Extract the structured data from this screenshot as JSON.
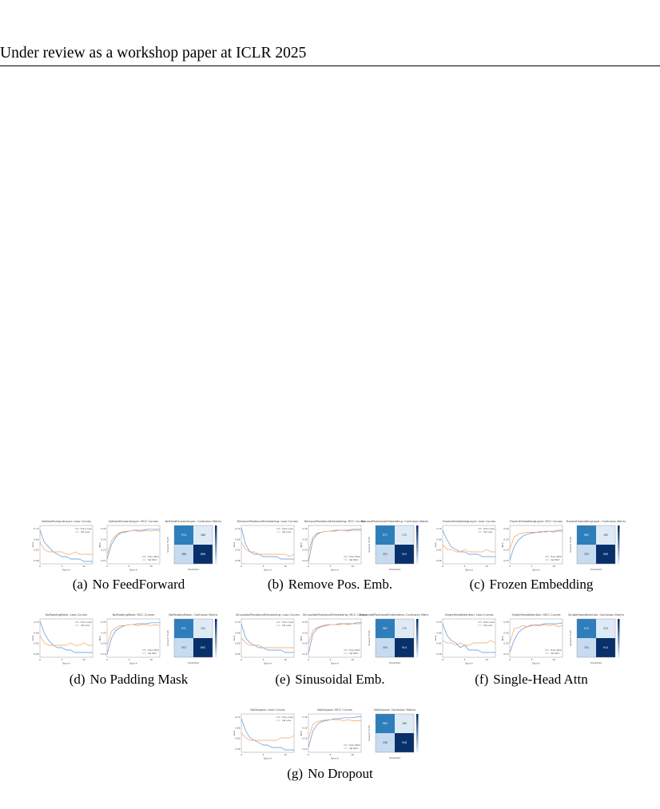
{
  "header": {
    "text": "Under review as a workshop paper at ICLR 2025"
  },
  "colors": {
    "train": "#5b8fd6",
    "val": "#f5a05b",
    "cm_dark": "#08306b",
    "cm_mid": "#2e7ebc",
    "cm_light": "#deebf7",
    "cm_lighter": "#c6dbef"
  },
  "panels": [
    {
      "label": "(a)",
      "caption": "No FeedForward",
      "loss_title": "NoFeedForwardLayer: Loss Curves",
      "mcc_title": "NoFeedForwardLayer: MCC Curves",
      "cm_title": "NoFeedForwardLayer: Confusion Matrix",
      "legend_loss": [
        "Train Loss",
        "Val Loss"
      ],
      "legend_mcc": [
        "Train MCC",
        "Val MCC"
      ],
      "xlabel": "Epoch",
      "ylabel_loss": "Loss",
      "ylabel_mcc": "MCC",
      "cm_xlabel": "Predicted",
      "cm_ylabel": "Ground Truth",
      "loss_ticks": [
        "0.70",
        "0.66",
        "0.62",
        "0.58"
      ],
      "x_ticks": [
        "0",
        "5",
        "10"
      ],
      "chart_data": {
        "type": "line",
        "x": [
          0,
          1,
          2,
          3,
          4,
          5,
          6,
          7,
          8,
          9,
          10,
          11,
          12
        ],
        "series": [
          {
            "name": "Train Loss",
            "values": [
              0.71,
              0.66,
              0.64,
              0.62,
              0.61,
              0.6,
              0.6,
              0.59,
              0.59,
              0.59,
              0.58,
              0.58,
              0.58
            ]
          },
          {
            "name": "Val Loss",
            "values": [
              0.66,
              0.63,
              0.62,
              0.62,
              0.62,
              0.62,
              0.61,
              0.61,
              0.62,
              0.61,
              0.61,
              0.61,
              0.61
            ]
          },
          {
            "name": "Train MCC",
            "values": [
              0.05,
              0.2,
              0.28,
              0.32,
              0.33,
              0.34,
              0.35,
              0.35,
              0.35,
              0.36,
              0.36,
              0.36,
              0.36
            ]
          },
          {
            "name": "Val MCC",
            "values": [
              0.1,
              0.24,
              0.3,
              0.33,
              0.34,
              0.34,
              0.35,
              0.34,
              0.34,
              0.35,
              0.34,
              0.35,
              0.34
            ]
          }
        ]
      },
      "cm": {
        "values": [
          "974",
          "186",
          "368",
          "896"
        ],
        "shade": [
          "mid",
          "light",
          "lighter",
          "dark"
        ]
      }
    },
    {
      "label": "(b)",
      "caption": "Remove Pos. Emb.",
      "loss_title": "RemovePositionalEmbedding: Loss Curves",
      "mcc_title": "RemovePositionalEmbedding: MCC Curves",
      "cm_title": "RemovePositionalEmbedding: Confusion Matrix",
      "legend_loss": [
        "Train Loss",
        "Val Loss"
      ],
      "legend_mcc": [
        "Train MCC",
        "Val MCC"
      ],
      "xlabel": "Epoch",
      "ylabel_loss": "Loss",
      "ylabel_mcc": "MCC",
      "cm_xlabel": "Predicted",
      "cm_ylabel": "Ground Truth",
      "loss_ticks": [
        "0.70",
        "0.66",
        "0.62",
        "0.58"
      ],
      "x_ticks": [
        "0",
        "5",
        "10"
      ],
      "chart_data": {
        "type": "line",
        "x": [
          0,
          1,
          2,
          3,
          4,
          5,
          6,
          7,
          8,
          9,
          10,
          11,
          12
        ],
        "series": [
          {
            "name": "Train Loss",
            "values": [
              0.72,
              0.65,
              0.62,
              0.61,
              0.61,
              0.6,
              0.6,
              0.6,
              0.6,
              0.59,
              0.59,
              0.59,
              0.59
            ]
          },
          {
            "name": "Val Loss",
            "values": [
              0.66,
              0.63,
              0.62,
              0.62,
              0.61,
              0.61,
              0.61,
              0.61,
              0.61,
              0.61,
              0.61,
              0.6,
              0.61
            ]
          },
          {
            "name": "Train MCC",
            "values": [
              0.02,
              0.25,
              0.31,
              0.33,
              0.34,
              0.34,
              0.35,
              0.35,
              0.35,
              0.35,
              0.36,
              0.36,
              0.36
            ]
          },
          {
            "name": "Val MCC",
            "values": [
              0.12,
              0.28,
              0.32,
              0.33,
              0.34,
              0.34,
              0.34,
              0.35,
              0.35,
              0.34,
              0.35,
              0.35,
              0.35
            ]
          }
        ]
      },
      "cm": {
        "values": [
          "971",
          "172",
          "351",
          "913"
        ],
        "shade": [
          "mid",
          "light",
          "lighter",
          "dark"
        ]
      }
    },
    {
      "label": "(c)",
      "caption": "Frozen Embedding",
      "loss_title": "FrozenEmbeddingLayer: Loss Curves",
      "mcc_title": "FrozenEmbeddingLayer: MCC Curves",
      "cm_title": "FrozenEmbeddingLayer: Confusion Matrix",
      "legend_loss": [
        "Train Loss",
        "Val Loss"
      ],
      "legend_mcc": [
        "Train MCC",
        "Val MCC"
      ],
      "xlabel": "Epoch",
      "ylabel_loss": "Loss",
      "ylabel_mcc": "MCC",
      "cm_xlabel": "Predicted",
      "cm_ylabel": "Ground Truth",
      "loss_ticks": [
        "0.70",
        "0.66",
        "0.62",
        "0.58"
      ],
      "x_ticks": [
        "0",
        "5",
        "10"
      ],
      "chart_data": {
        "type": "line",
        "x": [
          0,
          1,
          2,
          3,
          4,
          5,
          6,
          7,
          8,
          9,
          10,
          11,
          12
        ],
        "series": [
          {
            "name": "Train Loss",
            "values": [
              0.71,
              0.67,
              0.64,
              0.63,
              0.62,
              0.62,
              0.61,
              0.61,
              0.61,
              0.6,
              0.6,
              0.6,
              0.6
            ]
          },
          {
            "name": "Val Loss",
            "values": [
              0.65,
              0.63,
              0.63,
              0.62,
              0.62,
              0.63,
              0.62,
              0.62,
              0.62,
              0.62,
              0.63,
              0.62,
              0.62
            ]
          },
          {
            "name": "Train MCC",
            "values": [
              0.04,
              0.18,
              0.25,
              0.29,
              0.31,
              0.32,
              0.33,
              0.33,
              0.34,
              0.34,
              0.34,
              0.35,
              0.35
            ]
          },
          {
            "name": "Val MCC",
            "values": [
              0.15,
              0.28,
              0.31,
              0.32,
              0.33,
              0.33,
              0.33,
              0.34,
              0.33,
              0.34,
              0.33,
              0.34,
              0.34
            ]
          }
        ]
      },
      "cm": {
        "values": [
          "961",
          "183",
          "353",
          "909"
        ],
        "shade": [
          "mid",
          "light",
          "lighter",
          "dark"
        ]
      }
    },
    {
      "label": "(d)",
      "caption": "No Padding Mask",
      "loss_title": "NoPaddingMask: Loss Curves",
      "mcc_title": "NoPaddingMask: MCC Curves",
      "cm_title": "NoPaddingMask: Confusion Matrix",
      "legend_loss": [
        "Train Loss",
        "Val Loss"
      ],
      "legend_mcc": [
        "Train MCC",
        "Val MCC"
      ],
      "xlabel": "Epoch",
      "ylabel_loss": "Loss",
      "ylabel_mcc": "MCC",
      "cm_xlabel": "Predicted",
      "cm_ylabel": "Ground Truth",
      "loss_ticks": [
        "0.70",
        "0.66",
        "0.62",
        "0.58"
      ],
      "x_ticks": [
        "0",
        "5",
        "10"
      ],
      "chart_data": {
        "type": "line",
        "x": [
          0,
          1,
          2,
          3,
          4,
          5,
          6,
          7,
          8,
          9,
          10,
          11,
          12
        ],
        "series": [
          {
            "name": "Train Loss",
            "values": [
              0.72,
              0.67,
              0.64,
              0.62,
              0.61,
              0.61,
              0.6,
              0.6,
              0.59,
              0.59,
              0.59,
              0.59,
              0.59
            ]
          },
          {
            "name": "Val Loss",
            "values": [
              0.66,
              0.63,
              0.62,
              0.62,
              0.62,
              0.62,
              0.62,
              0.63,
              0.62,
              0.62,
              0.63,
              0.62,
              0.62
            ]
          },
          {
            "name": "Train MCC",
            "values": [
              0.03,
              0.2,
              0.28,
              0.31,
              0.33,
              0.34,
              0.34,
              0.35,
              0.35,
              0.35,
              0.36,
              0.36,
              0.36
            ]
          },
          {
            "name": "Val MCC",
            "values": [
              0.12,
              0.27,
              0.31,
              0.33,
              0.33,
              0.34,
              0.34,
              0.33,
              0.34,
              0.34,
              0.33,
              0.34,
              0.33
            ]
          }
        ]
      },
      "cm": {
        "values": [
          "972",
          "192",
          "353",
          "892"
        ],
        "shade": [
          "mid",
          "light",
          "lighter",
          "dark"
        ]
      }
    },
    {
      "label": "(e)",
      "caption": "Sinusoidal Emb.",
      "loss_title": "SinusoidalPositionalEmbedding: Loss Curves",
      "mcc_title": "SinusoidalPositionalEmbedding: MCC Curves",
      "cm_title": "SinusoidalPositionalEmbedding: Confusion Matrix",
      "legend_loss": [
        "Train Loss",
        "Val Loss"
      ],
      "legend_mcc": [
        "Train MCC",
        "Val MCC"
      ],
      "xlabel": "Epoch",
      "ylabel_loss": "Loss",
      "ylabel_mcc": "MCC",
      "cm_xlabel": "Predicted",
      "cm_ylabel": "Ground Truth",
      "loss_ticks": [
        "0.70",
        "0.66",
        "0.62",
        "0.58"
      ],
      "x_ticks": [
        "0",
        "5",
        "10"
      ],
      "chart_data": {
        "type": "line",
        "x": [
          0,
          1,
          2,
          3,
          4,
          5,
          6,
          7,
          8,
          9,
          10,
          11,
          12
        ],
        "series": [
          {
            "name": "Train Loss",
            "values": [
              0.71,
              0.65,
              0.63,
              0.62,
              0.61,
              0.61,
              0.6,
              0.6,
              0.6,
              0.6,
              0.59,
              0.59,
              0.59
            ]
          },
          {
            "name": "Val Loss",
            "values": [
              0.65,
              0.63,
              0.62,
              0.62,
              0.62,
              0.61,
              0.61,
              0.61,
              0.61,
              0.61,
              0.61,
              0.61,
              0.61
            ]
          },
          {
            "name": "Train MCC",
            "values": [
              0.04,
              0.24,
              0.3,
              0.32,
              0.33,
              0.34,
              0.34,
              0.35,
              0.35,
              0.35,
              0.35,
              0.36,
              0.36
            ]
          },
          {
            "name": "Val MCC",
            "values": [
              0.14,
              0.28,
              0.31,
              0.33,
              0.34,
              0.34,
              0.34,
              0.34,
              0.35,
              0.34,
              0.35,
              0.35,
              0.35
            ]
          }
        ]
      },
      "cm": {
        "values": [
          "967",
          "172",
          "354",
          "914"
        ],
        "shade": [
          "mid",
          "light",
          "lighter",
          "dark"
        ]
      }
    },
    {
      "label": "(f)",
      "caption": "Single-Head Attn",
      "loss_title": "SingleHeadAttention: Loss Curves",
      "mcc_title": "SingleHeadAttention: MCC Curves",
      "cm_title": "SingleHeadAttention: Confusion Matrix",
      "legend_loss": [
        "Train Loss",
        "Val Loss"
      ],
      "legend_mcc": [
        "Train MCC",
        "Val MCC"
      ],
      "xlabel": "Epoch",
      "ylabel_loss": "Loss",
      "ylabel_mcc": "MCC",
      "cm_xlabel": "Predicted",
      "cm_ylabel": "Ground Truth",
      "loss_ticks": [
        "0.70",
        "0.66",
        "0.62",
        "0.58"
      ],
      "x_ticks": [
        "0",
        "5",
        "10"
      ],
      "chart_data": {
        "type": "line",
        "x": [
          0,
          1,
          2,
          3,
          4,
          5,
          6,
          7,
          8,
          9,
          10,
          11,
          12
        ],
        "series": [
          {
            "name": "Train Loss",
            "values": [
              0.71,
              0.66,
              0.64,
              0.63,
              0.61,
              0.62,
              0.6,
              0.6,
              0.6,
              0.59,
              0.59,
              0.59,
              0.59
            ]
          },
          {
            "name": "Val Loss",
            "values": [
              0.64,
              0.63,
              0.63,
              0.62,
              0.63,
              0.62,
              0.62,
              0.63,
              0.63,
              0.63,
              0.63,
              0.64,
              0.63
            ]
          },
          {
            "name": "Train MCC",
            "values": [
              0.05,
              0.18,
              0.26,
              0.3,
              0.32,
              0.33,
              0.34,
              0.34,
              0.35,
              0.35,
              0.35,
              0.35,
              0.36
            ]
          },
          {
            "name": "Val MCC",
            "values": [
              0.15,
              0.3,
              0.31,
              0.33,
              0.32,
              0.34,
              0.33,
              0.33,
              0.34,
              0.33,
              0.34,
              0.32,
              0.33
            ]
          }
        ]
      },
      "cm": {
        "values": [
          "913",
          "223",
          "332",
          "914"
        ],
        "shade": [
          "mid",
          "light",
          "lighter",
          "dark"
        ]
      }
    },
    {
      "label": "(g)",
      "caption": "No Dropout",
      "loss_title": "NoDropout: Loss Curves",
      "mcc_title": "NoDropout: MCC Curves",
      "cm_title": "NoDropout: Confusion Matrix",
      "legend_loss": [
        "Train Loss",
        "Val Loss"
      ],
      "legend_mcc": [
        "Train MCC",
        "Val MCC"
      ],
      "xlabel": "Epoch",
      "ylabel_loss": "Loss",
      "ylabel_mcc": "MCC",
      "cm_xlabel": "Predicted",
      "cm_ylabel": "Ground Truth",
      "loss_ticks": [
        "0.70",
        "0.66",
        "0.62",
        "0.58"
      ],
      "x_ticks": [
        "0",
        "5",
        "10"
      ],
      "chart_data": {
        "type": "line",
        "x": [
          0,
          1,
          2,
          3,
          4,
          5,
          6,
          7,
          8,
          9,
          10,
          11,
          12
        ],
        "series": [
          {
            "name": "Train Loss",
            "values": [
              0.71,
              0.66,
              0.63,
              0.62,
              0.61,
              0.6,
              0.6,
              0.59,
              0.59,
              0.59,
              0.58,
              0.58,
              0.58
            ]
          },
          {
            "name": "Val Loss",
            "values": [
              0.65,
              0.63,
              0.62,
              0.62,
              0.62,
              0.62,
              0.62,
              0.62,
              0.62,
              0.63,
              0.63,
              0.63,
              0.64
            ]
          },
          {
            "name": "Train MCC",
            "values": [
              0.05,
              0.22,
              0.29,
              0.32,
              0.33,
              0.34,
              0.35,
              0.35,
              0.36,
              0.36,
              0.36,
              0.37,
              0.37
            ]
          },
          {
            "name": "Val MCC",
            "values": [
              0.14,
              0.29,
              0.32,
              0.33,
              0.34,
              0.34,
              0.34,
              0.34,
              0.33,
              0.34,
              0.33,
              0.33,
              0.33
            ]
          }
        ]
      },
      "cm": {
        "values": [
          "963",
          "189",
          "356",
          "918"
        ],
        "shade": [
          "mid",
          "light",
          "lighter",
          "dark"
        ]
      }
    }
  ]
}
